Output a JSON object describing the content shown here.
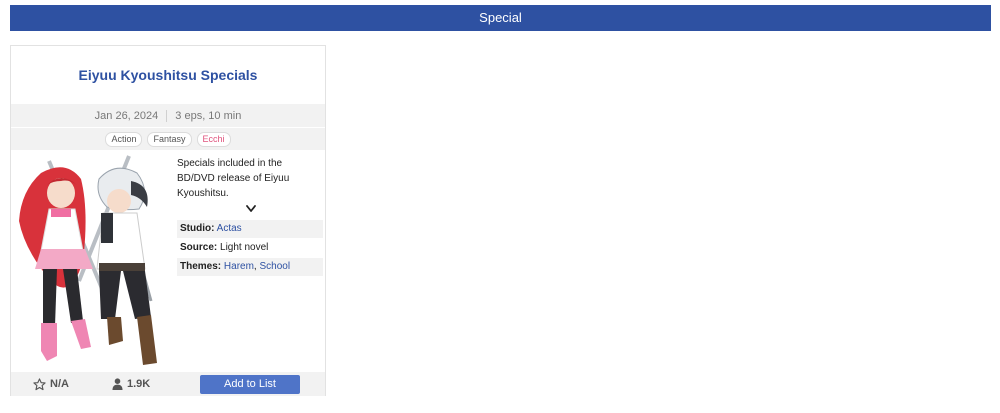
{
  "section": {
    "title": "Special"
  },
  "card": {
    "title": "Eiyuu Kyoushitsu Specials",
    "date": "Jan 26, 2024",
    "episodes": "3 eps, 10 min",
    "genres": [
      "Action",
      "Fantasy",
      "Ecchi"
    ],
    "synopsis": "Specials included in the BD/DVD release of Eiyuu Kyoushitsu.",
    "studio": {
      "label": "Studio:",
      "value": "Actas"
    },
    "source": {
      "label": "Source:",
      "value": "Light novel"
    },
    "themes": {
      "label": "Themes:",
      "values": [
        "Harem",
        "School"
      ],
      "separator": ", "
    },
    "score": "N/A",
    "members": "1.9K",
    "add_button": "Add to List"
  }
}
